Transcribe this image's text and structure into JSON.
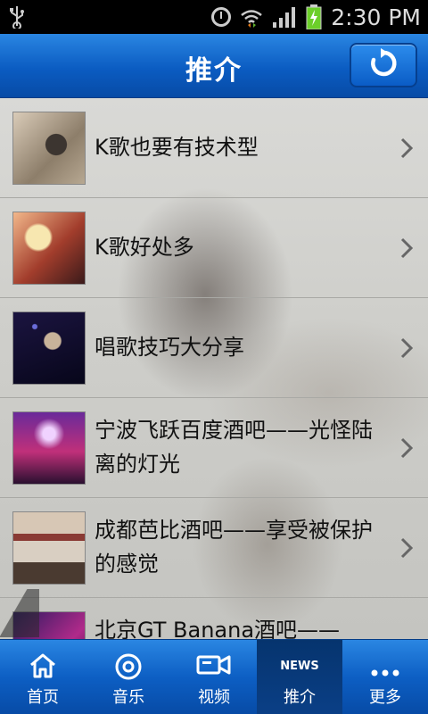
{
  "status_bar": {
    "time": "2:30 PM",
    "icons": [
      "usb-icon",
      "alarm-icon",
      "wifi-icon",
      "signal-icon",
      "battery-icon"
    ]
  },
  "header": {
    "title": "推介",
    "refresh_icon": "refresh-icon"
  },
  "list": {
    "items": [
      {
        "title": "K歌也要有技术型"
      },
      {
        "title": "K歌好处多"
      },
      {
        "title": "唱歌技巧大分享"
      },
      {
        "title": "宁波飞跃百度酒吧——光怪陆离的灯光"
      },
      {
        "title": "成都芭比酒吧——享受被保护的感觉"
      },
      {
        "title": "北京GT Banana酒吧——"
      }
    ]
  },
  "tabbar": {
    "tabs": [
      {
        "label": "首页",
        "icon": "home-icon"
      },
      {
        "label": "音乐",
        "icon": "music-disc-icon"
      },
      {
        "label": "视频",
        "icon": "video-camera-icon"
      },
      {
        "label": "推介",
        "icon_text": "NEWS",
        "active": true
      },
      {
        "label": "更多",
        "icon": "more-dots-icon"
      }
    ]
  },
  "colors": {
    "header_blue": "#0b5cc2",
    "active_tab": "#06346e",
    "list_bg": "#d2d2ce"
  }
}
